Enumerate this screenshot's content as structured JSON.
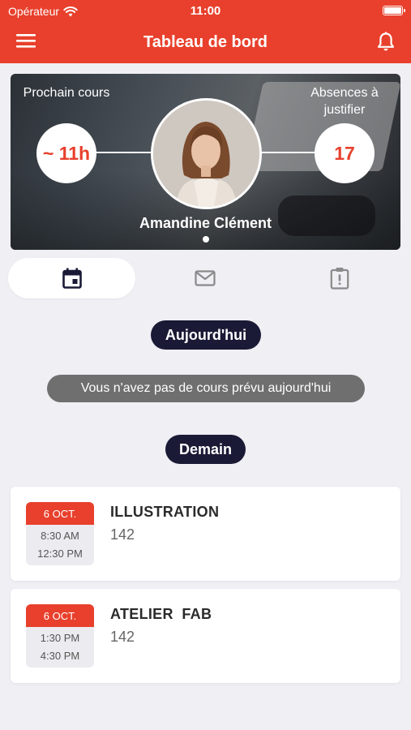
{
  "status_bar": {
    "carrier": "Opérateur",
    "time": "11:00"
  },
  "nav": {
    "title": "Tableau de bord"
  },
  "hero": {
    "next_course_label": "Prochain cours",
    "next_course_value": "~ 11h",
    "absences_label": "Absences à justifier",
    "absences_value": "17",
    "student_name": "Amandine Clément"
  },
  "tabs": [
    {
      "name": "calendar",
      "icon": "calendar-icon",
      "active": true
    },
    {
      "name": "messages",
      "icon": "mail-icon",
      "active": false
    },
    {
      "name": "absences",
      "icon": "clipboard-alert-icon",
      "active": false
    }
  ],
  "sections": {
    "today": "Aujourd'hui",
    "no_course_today": "Vous n'avez pas de cours prévu aujourd'hui",
    "tomorrow": "Demain"
  },
  "courses": [
    {
      "date": "6 OCT.",
      "start": "8:30 AM",
      "end": "12:30 PM",
      "title": "ILLUSTRATION",
      "room": "142"
    },
    {
      "date": "6 OCT.",
      "start": "1:30 PM",
      "end": "4:30 PM",
      "title": "ATELIER  FAB",
      "room": "142"
    }
  ],
  "colors": {
    "accent": "#e8402c",
    "pill": "#1a1a36",
    "background": "#efeff4"
  }
}
